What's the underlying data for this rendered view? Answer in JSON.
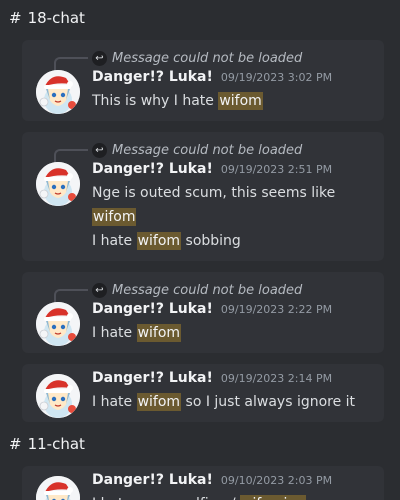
{
  "sections": [
    {
      "channel": "18-chat",
      "messages": [
        {
          "reply": "Message could not be loaded",
          "author": "Danger!? Luka!",
          "time": "09/19/2023 3:02 PM",
          "lines": [
            [
              {
                "t": "This is why I hate "
              },
              {
                "t": "wifom",
                "hl": true
              }
            ]
          ]
        },
        {
          "reply": "Message could not be loaded",
          "author": "Danger!? Luka!",
          "time": "09/19/2023 2:51 PM",
          "lines": [
            [
              {
                "t": "Nge is outed scum, this seems like "
              },
              {
                "t": "wifom",
                "hl": true
              }
            ],
            [
              {
                "t": "I hate "
              },
              {
                "t": "wifom",
                "hl": true
              },
              {
                "t": " sobbing"
              }
            ]
          ]
        },
        {
          "reply": "Message could not be loaded",
          "author": "Danger!? Luka!",
          "time": "09/19/2023 2:22 PM",
          "lines": [
            [
              {
                "t": "I hate "
              },
              {
                "t": "wifom",
                "hl": true
              }
            ]
          ]
        },
        {
          "reply": null,
          "author": "Danger!? Luka!",
          "time": "09/19/2023 2:14 PM",
          "lines": [
            [
              {
                "t": "I hate "
              },
              {
                "t": "wifom",
                "hl": true
              },
              {
                "t": " so I just always ignore it"
              }
            ]
          ]
        }
      ]
    },
    {
      "channel": "11-chat",
      "messages": [
        {
          "reply": null,
          "author": "Danger!? Luka!",
          "time": "09/10/2023 2:03 PM",
          "lines": [
            [
              {
                "t": "I hate open wolfing / "
              },
              {
                "t": "wifoming",
                "hl": true
              }
            ]
          ]
        }
      ]
    }
  ],
  "icons": {
    "channel": "hash-icon",
    "reply": "reply-arrow-icon",
    "avatar": "avatar-santa-character"
  },
  "colors": {
    "background": "#2b2d31",
    "card": "#313338",
    "highlight": "#6b5a30"
  }
}
